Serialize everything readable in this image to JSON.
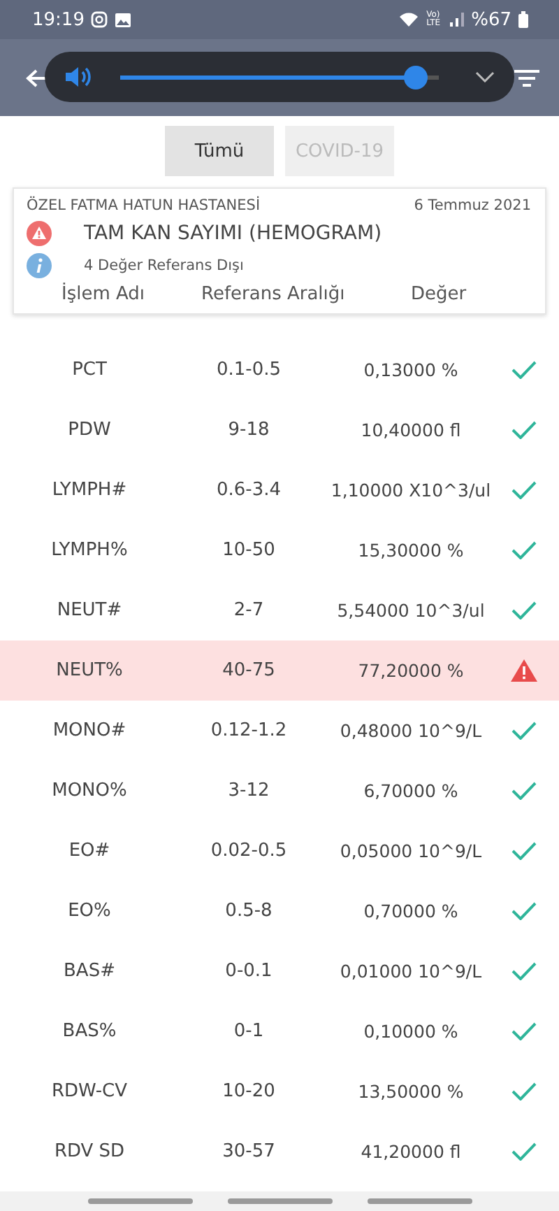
{
  "status_bar": {
    "time": "19:19",
    "volte": "Vo) LTE",
    "battery": "%67"
  },
  "volume_overlay": {
    "level": 0.93
  },
  "tabs": [
    {
      "label": "Tümü",
      "selected": true
    },
    {
      "label": "COVID-19",
      "selected": false
    }
  ],
  "report": {
    "hospital": "ÖZEL FATMA HATUN HASTANESİ",
    "date": "6 Temmuz 2021",
    "test": "TAM KAN SAYIMI (HEMOGRAM)",
    "note": "4 Değer Referans Dışı"
  },
  "table": {
    "columns": [
      "İşlem Adı",
      "Referans Aralığı",
      "Değer"
    ],
    "rows": [
      {
        "name": "PCT",
        "range": "0.1-0.5",
        "value": "0,13000 %",
        "flagged": false
      },
      {
        "name": "PDW",
        "range": "9-18",
        "value": "10,40000 fl",
        "flagged": false
      },
      {
        "name": "LYMPH#",
        "range": "0.6-3.4",
        "value": "1,10000 X10^3/ul",
        "flagged": false
      },
      {
        "name": "LYMPH%",
        "range": "10-50",
        "value": "15,30000 %",
        "flagged": false
      },
      {
        "name": "NEUT#",
        "range": "2-7",
        "value": "5,54000 10^3/ul",
        "flagged": false
      },
      {
        "name": "NEUT%",
        "range": "40-75",
        "value": "77,20000 %",
        "flagged": true
      },
      {
        "name": "MONO#",
        "range": "0.12-1.2",
        "value": "0,48000 10^9/L",
        "flagged": false
      },
      {
        "name": "MONO%",
        "range": "3-12",
        "value": "6,70000 %",
        "flagged": false
      },
      {
        "name": "EO#",
        "range": "0.02-0.5",
        "value": "0,05000 10^9/L",
        "flagged": false
      },
      {
        "name": "EO%",
        "range": "0.5-8",
        "value": "0,70000 %",
        "flagged": false
      },
      {
        "name": "BAS#",
        "range": "0-0.1",
        "value": "0,01000 10^9/L",
        "flagged": false
      },
      {
        "name": "BAS%",
        "range": "0-1",
        "value": "0,10000 %",
        "flagged": false
      },
      {
        "name": "RDW-CV",
        "range": "10-20",
        "value": "13,50000 %",
        "flagged": false
      },
      {
        "name": "RDV  SD",
        "range": "30-57",
        "value": "41,20000 fl",
        "flagged": false
      }
    ]
  }
}
